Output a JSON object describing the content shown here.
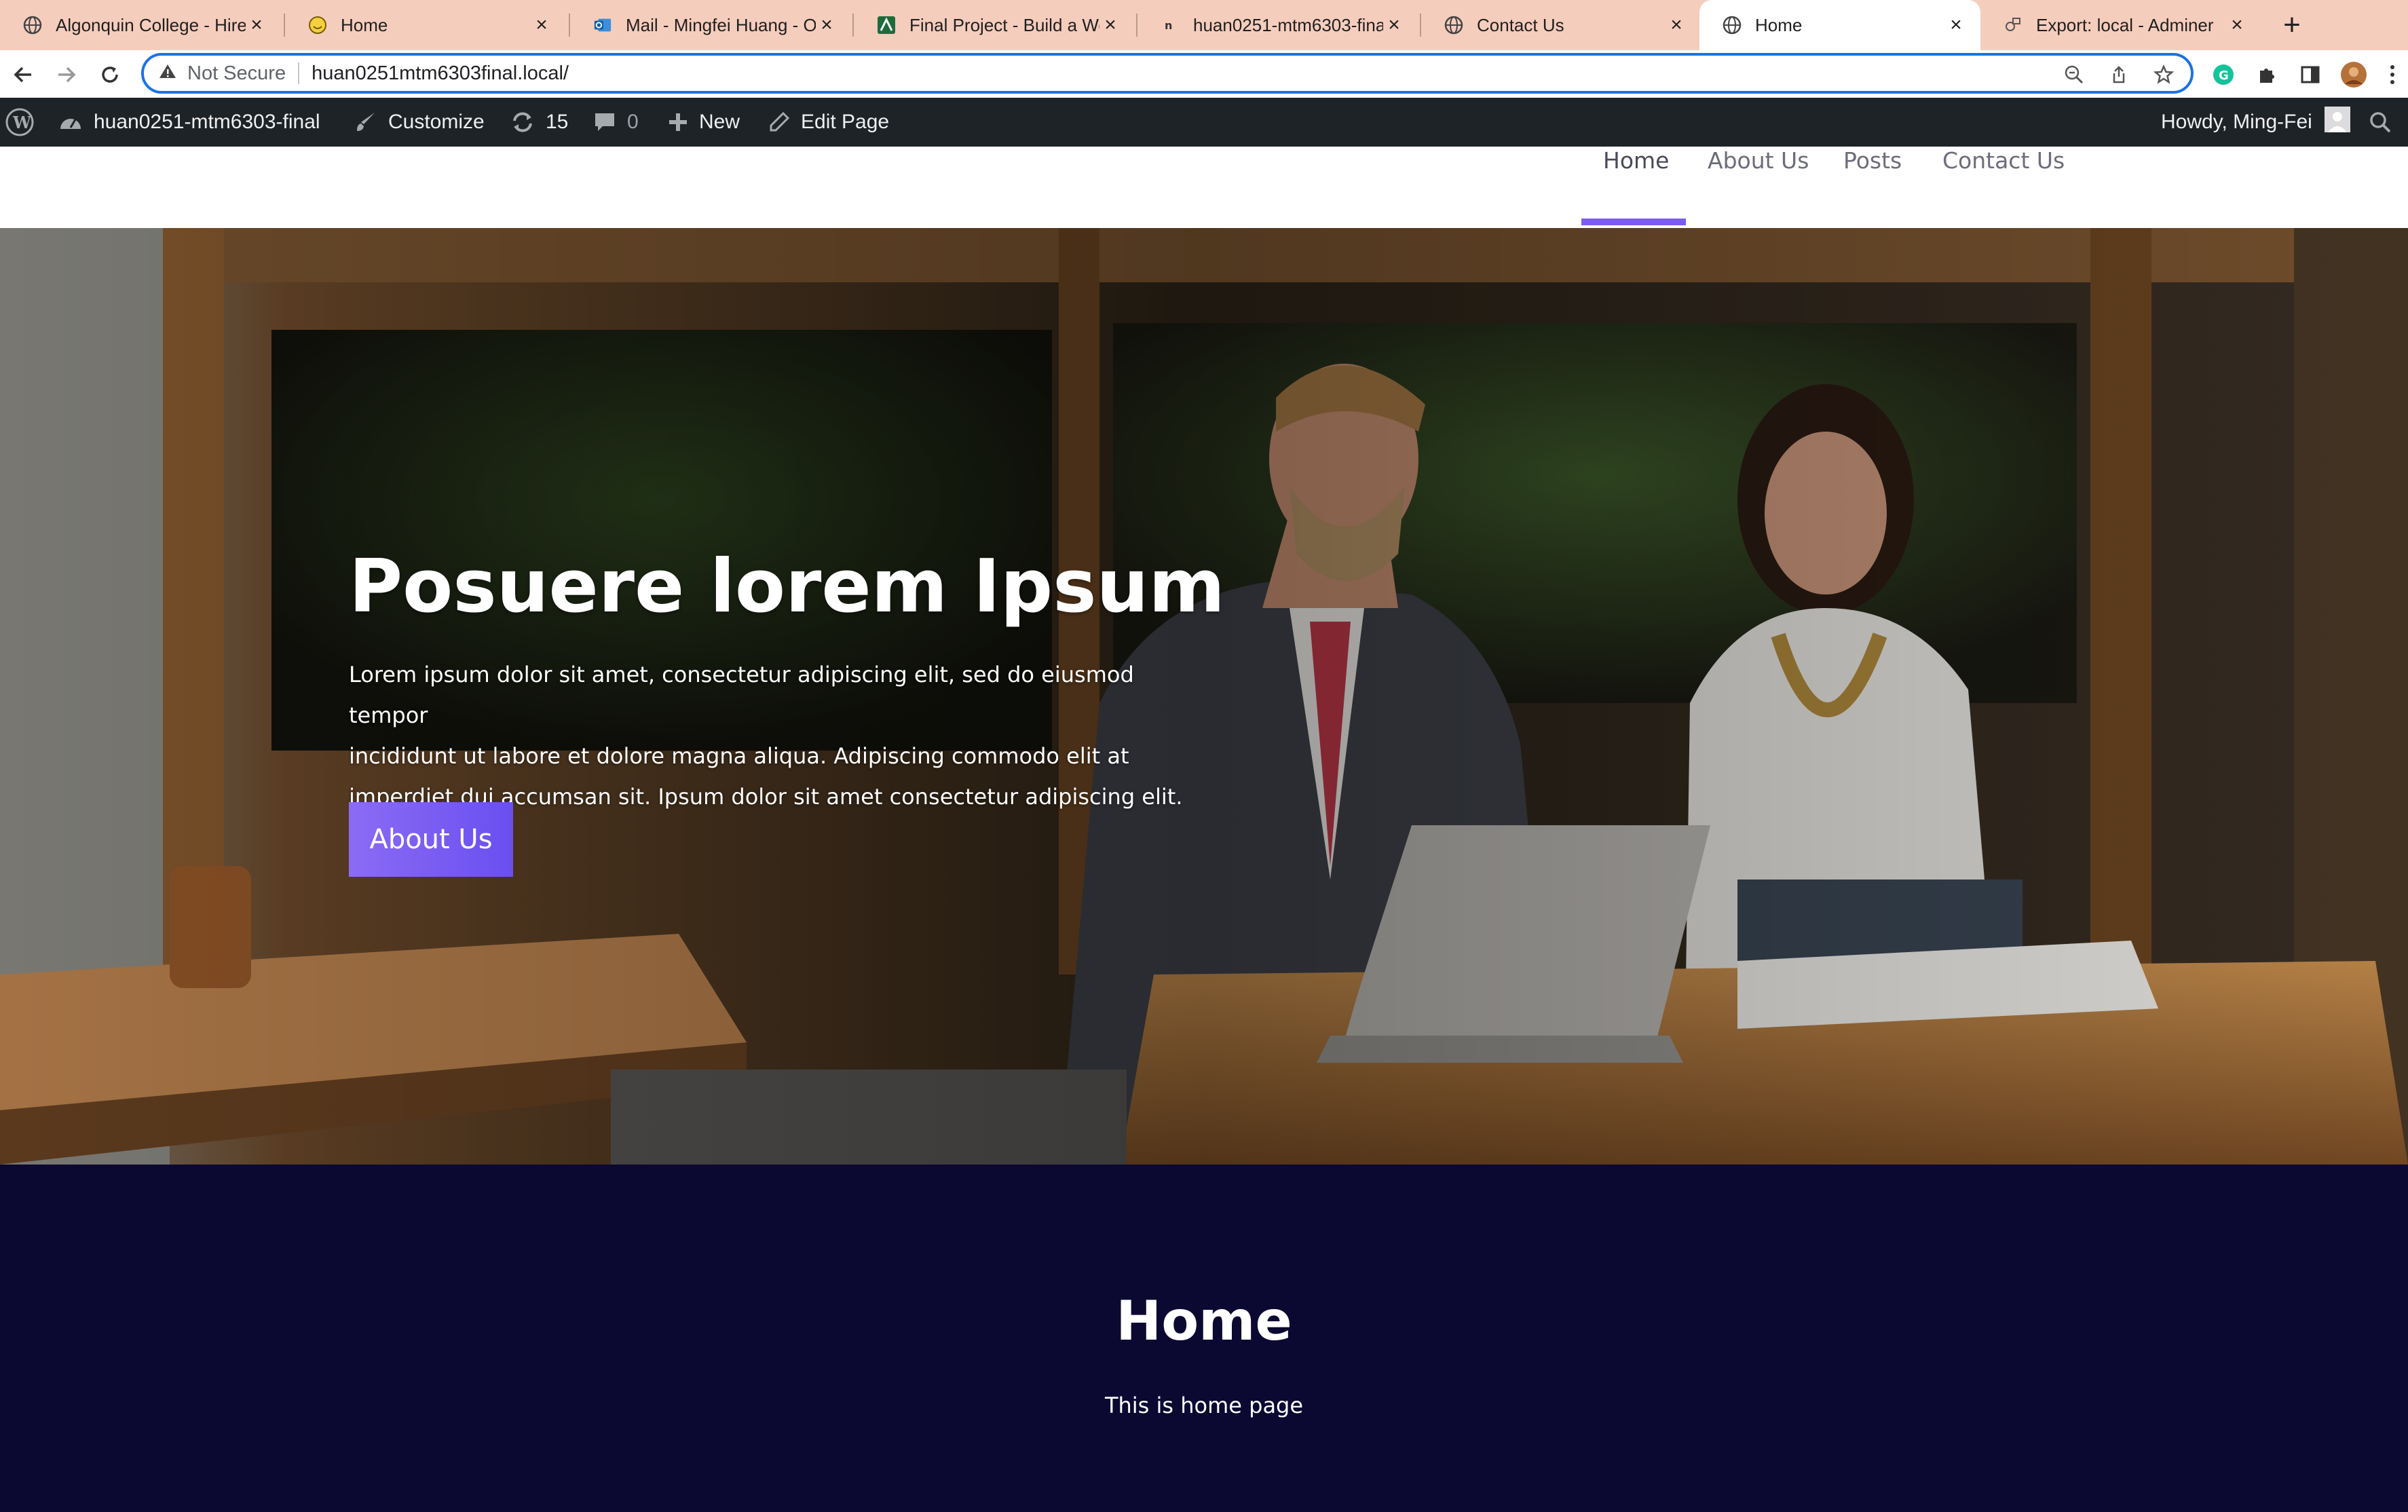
{
  "browser": {
    "tabs": [
      {
        "title": "Algonquin College - Hire/",
        "icon": "globe-icon",
        "active": false
      },
      {
        "title": "Home",
        "icon": "smiley-icon",
        "active": false
      },
      {
        "title": "Mail - Mingfei Huang - Ou",
        "icon": "outlook-icon",
        "active": false
      },
      {
        "title": "Final Project - Build a Wo",
        "icon": "brightspace-icon",
        "active": false
      },
      {
        "title": "huan0251-mtm6303-fina",
        "icon": "local-icon",
        "active": false
      },
      {
        "title": "Contact Us",
        "icon": "globe-icon",
        "active": false
      },
      {
        "title": "Home",
        "icon": "globe-icon",
        "active": true
      },
      {
        "title": "Export: local - Adminer",
        "icon": "adminer-icon",
        "active": false
      }
    ],
    "security_label": "Not Secure",
    "url": "huan0251mtm6303final.local/"
  },
  "adminbar": {
    "site_name": "huan0251-mtm6303-final",
    "customize": "Customize",
    "updates_count": "15",
    "comments_count": "0",
    "new_label": "New",
    "edit_label": "Edit Page",
    "howdy": "Howdy, Ming-Fei"
  },
  "menu": {
    "items": [
      "Home",
      "About Us",
      "Posts",
      "Contact Us"
    ],
    "active": "Home",
    "accent_color": "#7c5cf0"
  },
  "hero": {
    "title": "Posuere lorem Ipsum",
    "text_lines": [
      "Lorem ipsum dolor sit amet, consectetur adipiscing elit, sed do eiusmod tempor",
      "incididunt ut labore et dolore magna aliqua. Adipiscing commodo elit at",
      "imperdiet dui accumsan sit. Ipsum dolor sit amet consectetur adipiscing elit."
    ],
    "button_label": "About Us"
  },
  "home_section": {
    "title": "Home",
    "subtitle": "This is home page",
    "background": "#0b0832"
  }
}
